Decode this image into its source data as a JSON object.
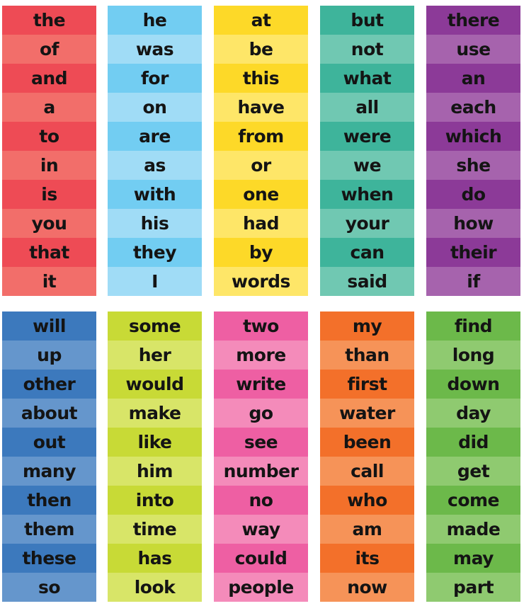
{
  "columns": [
    {
      "colors": [
        "#ee4b55",
        "#f26e6a"
      ],
      "words": [
        "the",
        "of",
        "and",
        "a",
        "to",
        "in",
        "is",
        "you",
        "that",
        "it"
      ]
    },
    {
      "colors": [
        "#72cdf2",
        "#a0dcf6"
      ],
      "words": [
        "he",
        "was",
        "for",
        "on",
        "are",
        "as",
        "with",
        "his",
        "they",
        "I"
      ]
    },
    {
      "colors": [
        "#fdd928",
        "#fee668"
      ],
      "words": [
        "at",
        "be",
        "this",
        "have",
        "from",
        "or",
        "one",
        "had",
        "by",
        "words"
      ]
    },
    {
      "colors": [
        "#3eb49b",
        "#70c8b2"
      ],
      "words": [
        "but",
        "not",
        "what",
        "all",
        "were",
        "we",
        "when",
        "your",
        "can",
        "said"
      ]
    },
    {
      "colors": [
        "#8c3a98",
        "#a663ad"
      ],
      "words": [
        "there",
        "use",
        "an",
        "each",
        "which",
        "she",
        "do",
        "how",
        "their",
        "if"
      ]
    },
    {
      "colors": [
        "#3c79bd",
        "#6596cc"
      ],
      "words": [
        "will",
        "up",
        "other",
        "about",
        "out",
        "many",
        "then",
        "them",
        "these",
        "so"
      ]
    },
    {
      "colors": [
        "#c8da36",
        "#d8e568"
      ],
      "words": [
        "some",
        "her",
        "would",
        "make",
        "like",
        "him",
        "into",
        "time",
        "has",
        "look"
      ]
    },
    {
      "colors": [
        "#ee5fa3",
        "#f48bba"
      ],
      "words": [
        "two",
        "more",
        "write",
        "go",
        "see",
        "number",
        "no",
        "way",
        "could",
        "people"
      ]
    },
    {
      "colors": [
        "#f3702a",
        "#f69358"
      ],
      "words": [
        "my",
        "than",
        "first",
        "water",
        "been",
        "call",
        "who",
        "am",
        "its",
        "now"
      ]
    },
    {
      "colors": [
        "#6cb94a",
        "#8fca70"
      ],
      "words": [
        "find",
        "long",
        "down",
        "day",
        "did",
        "get",
        "come",
        "made",
        "may",
        "part"
      ]
    }
  ]
}
